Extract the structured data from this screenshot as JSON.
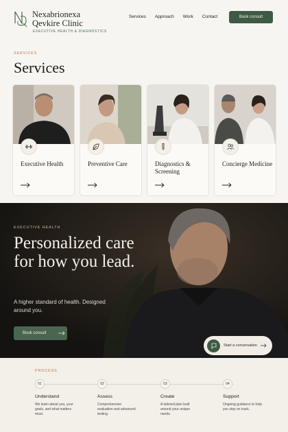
{
  "header": {
    "brand_line1": "Nexabrionexa",
    "brand_line2": "Qevkire Clinic",
    "tagline": "EXECUTIVE HEALTH & DIAGNOSTICS",
    "nav": [
      "Services",
      "Approach",
      "Work",
      "Contact"
    ],
    "cta": "Book consult"
  },
  "services": {
    "eyebrow": "SERVICES",
    "title": "Services",
    "cards": [
      {
        "title": "Executive Health",
        "icon": "dumbbell-icon"
      },
      {
        "title": "Preventive Care",
        "icon": "leaf-icon"
      },
      {
        "title": "Diagnostics & Screening",
        "icon": "test-tube-icon"
      },
      {
        "title": "Concierge Medicine",
        "icon": "people-icon"
      }
    ]
  },
  "hero": {
    "eyebrow": "EXECUTIVE HEALTH",
    "title": "Personalized care for how you lead.",
    "subtitle": "A higher standard of health. Designed around you.",
    "cta": "Book consult",
    "chat": "Start a conversation"
  },
  "process": {
    "eyebrow": "PROCESS",
    "steps": [
      {
        "num": "01",
        "title": "Understand",
        "desc": "We learn about you, your goals, and what matters most."
      },
      {
        "num": "02",
        "title": "Assess",
        "desc": "Comprehensive evaluation and advanced testing."
      },
      {
        "num": "03",
        "title": "Create",
        "desc": "A tailored plan built around your unique needs."
      },
      {
        "num": "04",
        "title": "Support",
        "desc": "Ongoing guidance to help you stay on track."
      }
    ]
  },
  "colors": {
    "accent": "#3f5a44",
    "eyebrow": "#b27a55",
    "hero_bg": "#141311"
  }
}
